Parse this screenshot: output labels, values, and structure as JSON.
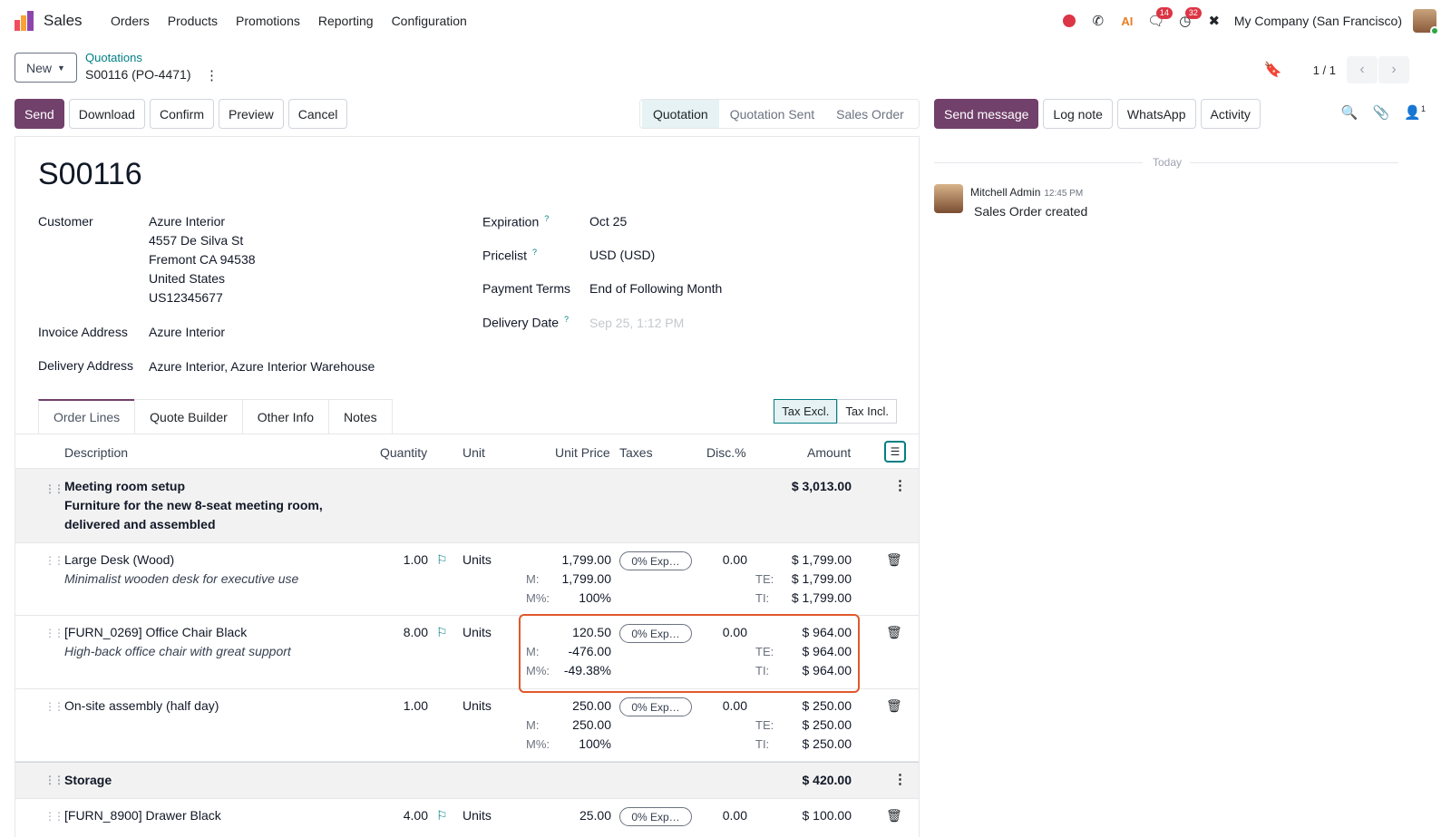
{
  "nav": {
    "app_name": "Sales",
    "menu": [
      "Orders",
      "Products",
      "Promotions",
      "Reporting",
      "Configuration"
    ],
    "messages_count": "14",
    "activities_count": "32",
    "company": "My Company (San Francisco)"
  },
  "control": {
    "new_label": "New",
    "breadcrumb": "Quotations",
    "record": "S00116 (PO-4471)",
    "pager": "1 / 1"
  },
  "actions": [
    "Send",
    "Download",
    "Confirm",
    "Preview",
    "Cancel"
  ],
  "status": [
    "Quotation",
    "Quotation Sent",
    "Sales Order"
  ],
  "form": {
    "title": "S00116",
    "customer_label": "Customer",
    "customer_lines": [
      "Azure Interior",
      "4557 De Silva St",
      "Fremont CA 94538",
      "United States",
      "US12345677"
    ],
    "invoice_label": "Invoice Address",
    "invoice_value": "Azure Interior",
    "delivery_label": "Delivery Address",
    "delivery_value": "Azure Interior, Azure Interior Warehouse",
    "expiration_label": "Expiration",
    "expiration_value": "Oct 25",
    "pricelist_label": "Pricelist",
    "pricelist_value": "USD (USD)",
    "terms_label": "Payment Terms",
    "terms_value": "End of Following Month",
    "delivery_date_label": "Delivery Date",
    "delivery_date_placeholder": "Sep 25, 1:12 PM",
    "help_mark": "?"
  },
  "tabs": [
    "Order Lines",
    "Quote Builder",
    "Other Info",
    "Notes"
  ],
  "tax_toggle": [
    "Tax Excl.",
    "Tax Incl."
  ],
  "columns": [
    "Description",
    "Quantity",
    "Unit",
    "Unit Price",
    "Taxes",
    "Disc.%",
    "Amount"
  ],
  "labels": {
    "m": "M:",
    "mp": "M%:",
    "te": "TE:",
    "ti": "TI:"
  },
  "lines": {
    "sec1": {
      "title": "Meeting room setup",
      "line2": "Furniture for the new 8-seat meeting room,",
      "line3": "delivered and assembled",
      "amount": "$ 3,013.00"
    },
    "desk": {
      "name": "Large Desk (Wood)",
      "desc": "Minimalist wooden desk for executive use",
      "qty": "1.00",
      "unit": "Units",
      "price": "1,799.00",
      "margin": "1,799.00",
      "margin_pct": "100%",
      "tax": "0% Exp…",
      "disc": "0.00",
      "amount": "$ 1,799.00",
      "te": "$ 1,799.00",
      "ti": "$ 1,799.00"
    },
    "chair": {
      "name": "[FURN_0269] Office Chair Black",
      "desc": "High-back office chair with great support",
      "qty": "8.00",
      "unit": "Units",
      "price": "120.50",
      "margin": "-476.00",
      "margin_pct": "-49.38%",
      "tax": "0% Exp…",
      "disc": "0.00",
      "amount": "$ 964.00",
      "te": "$ 964.00",
      "ti": "$ 964.00"
    },
    "assembly": {
      "name": "On-site assembly (half day)",
      "qty": "1.00",
      "unit": "Units",
      "price": "250.00",
      "margin": "250.00",
      "margin_pct": "100%",
      "tax": "0% Exp…",
      "disc": "0.00",
      "amount": "$ 250.00",
      "te": "$ 250.00",
      "ti": "$ 250.00"
    },
    "sec2": {
      "title": "Storage",
      "amount": "$ 420.00"
    },
    "drawer": {
      "name": "[FURN_8900] Drawer Black",
      "qty": "4.00",
      "unit": "Units",
      "price": "25.00",
      "tax": "0% Exp…",
      "disc": "0.00",
      "amount": "$ 100.00"
    }
  },
  "chatter": {
    "buttons": [
      "Send message",
      "Log note",
      "WhatsApp",
      "Activity"
    ],
    "followers": "1",
    "today": "Today",
    "author": "Mitchell Admin",
    "time": "12:45 PM",
    "body": "Sales Order created"
  },
  "colors": {
    "primary": "#71406b",
    "teal": "#017e84",
    "highlight": "#e0592a"
  }
}
